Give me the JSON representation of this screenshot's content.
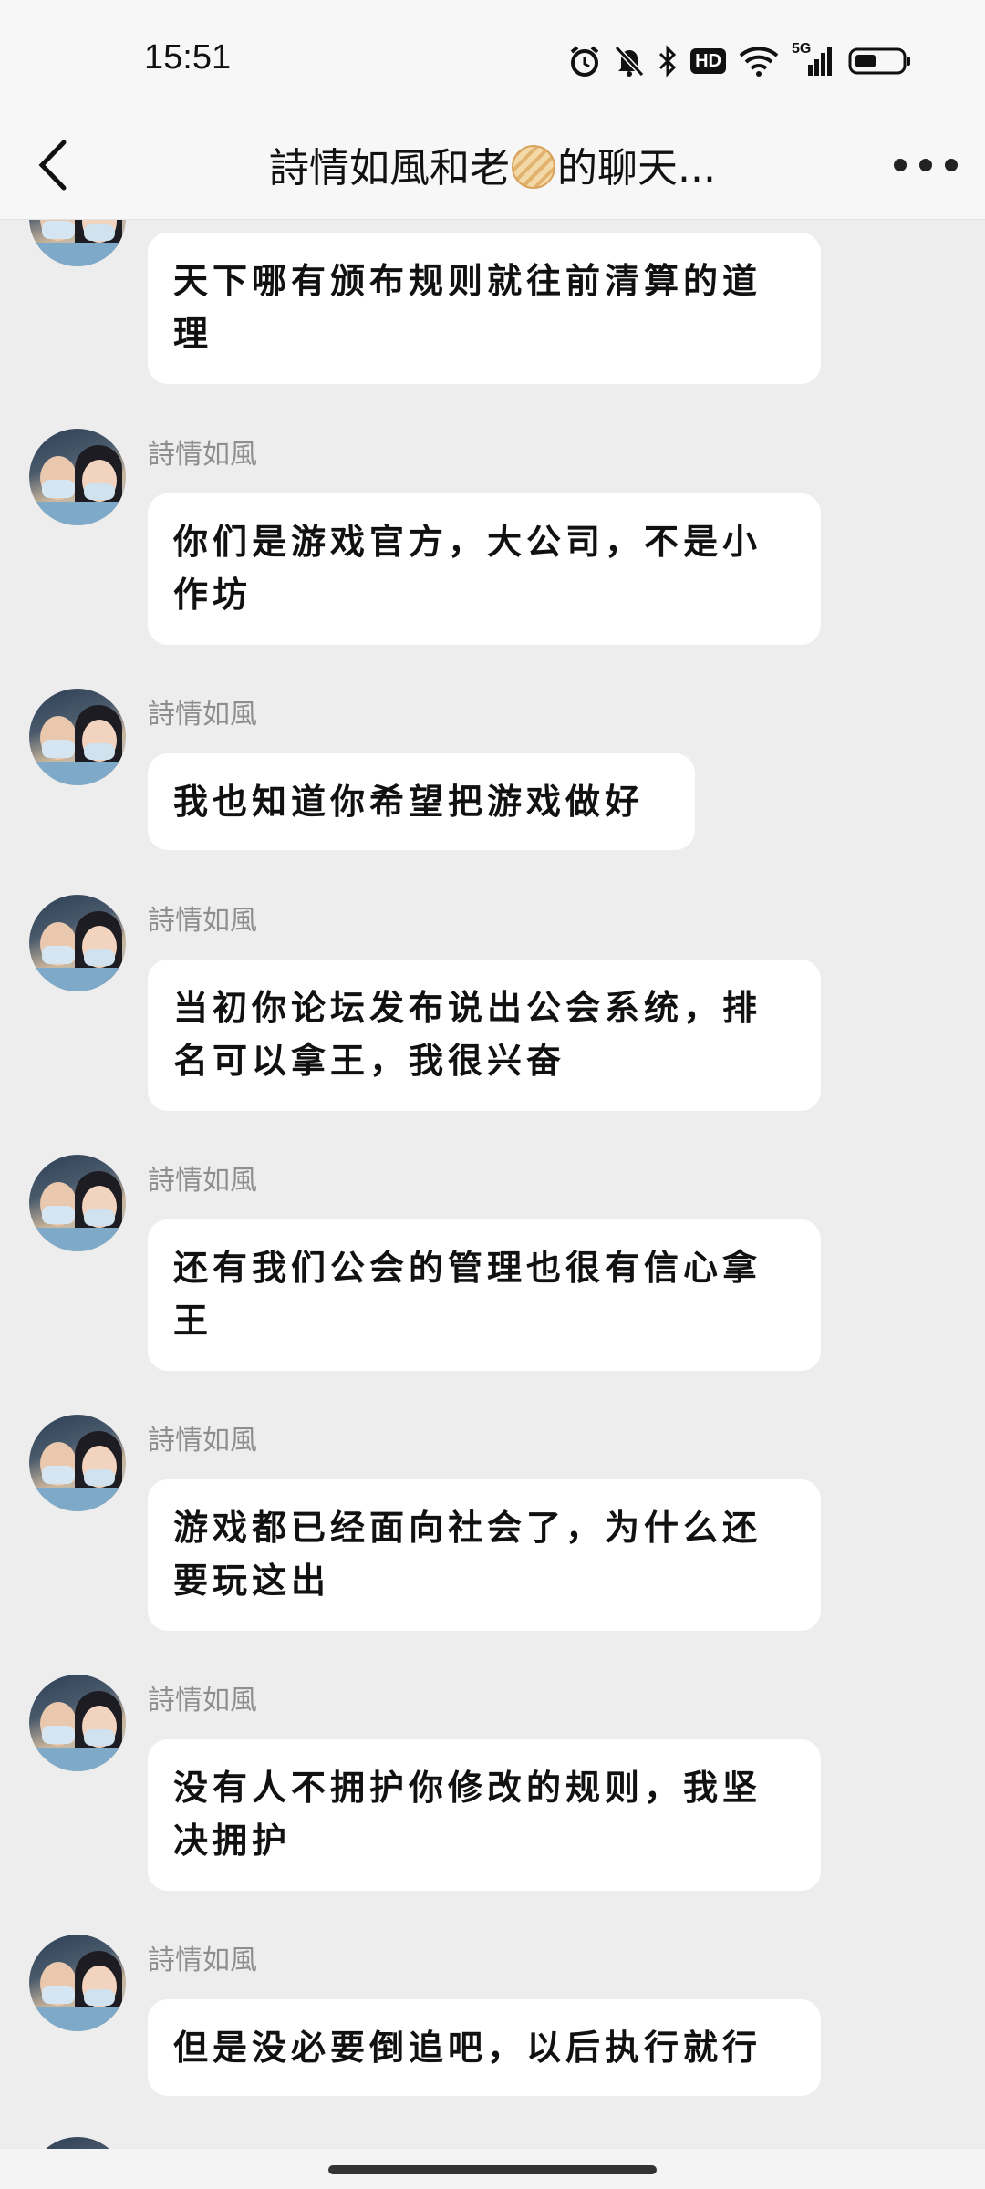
{
  "status_bar": {
    "time": "15:51",
    "icons": [
      "alarm-icon",
      "mute-icon",
      "bluetooth-icon",
      "hd-icon",
      "wifi-icon",
      "signal-5g-icon",
      "battery-icon"
    ],
    "hd_label": "HD",
    "network_label": "5G"
  },
  "header": {
    "title_prefix": "詩情如風和老",
    "title_suffix": "的聊天...",
    "emoji": "cookie-emoji-icon"
  },
  "messages": [
    {
      "sender": "",
      "text": "天下哪有颁布规则就往前清算的道理"
    },
    {
      "sender": "詩情如風",
      "text": "你们是游戏官方，大公司，不是小作坊"
    },
    {
      "sender": "詩情如風",
      "text": "我也知道你希望把游戏做好"
    },
    {
      "sender": "詩情如風",
      "text": "当初你论坛发布说出公会系统，排名可以拿王，我很兴奋"
    },
    {
      "sender": "詩情如風",
      "text": "还有我们公会的管理也很有信心拿王"
    },
    {
      "sender": "詩情如風",
      "text": "游戏都已经面向社会了，为什么还要玩这出"
    },
    {
      "sender": "詩情如風",
      "text": "没有人不拥护你修改的规则，我坚决拥护"
    },
    {
      "sender": "詩情如風",
      "text": "但是没必要倒追吧，以后执行就行"
    }
  ],
  "colors": {
    "background": "#ededed",
    "bubble": "#ffffff",
    "name": "#8e8e8e"
  }
}
